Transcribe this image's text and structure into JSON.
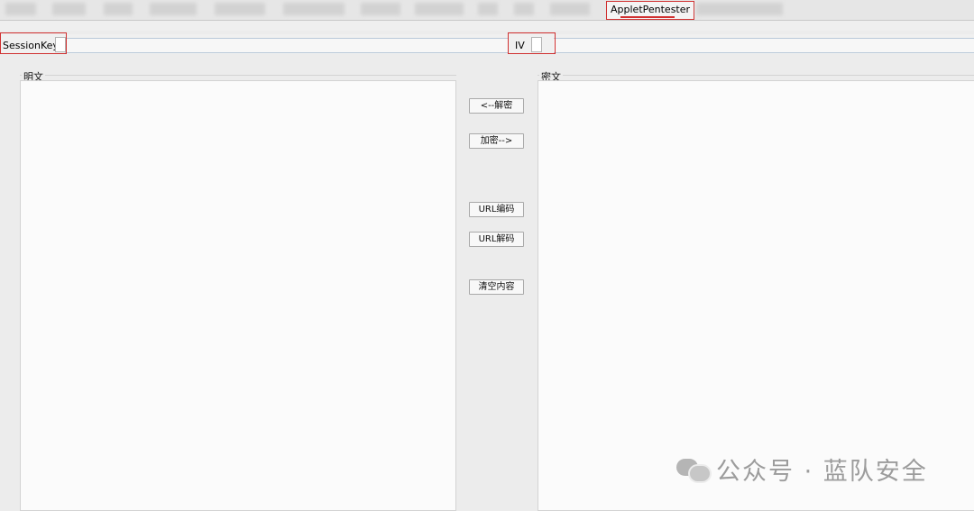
{
  "tabs": {
    "active_label": "AppletPentester",
    "blurred_count": 12
  },
  "keys": {
    "session_key_label": "SessionKey",
    "iv_label": "IV"
  },
  "panels": {
    "plaintext_label": "明文",
    "ciphertext_label": "密文"
  },
  "buttons": {
    "decrypt": "<--解密",
    "encrypt": "加密-->",
    "url_encode": "URL编码",
    "url_decode": "URL解码",
    "clear": "清空内容"
  },
  "watermark": {
    "text": "公众号 · 蓝队安全"
  }
}
